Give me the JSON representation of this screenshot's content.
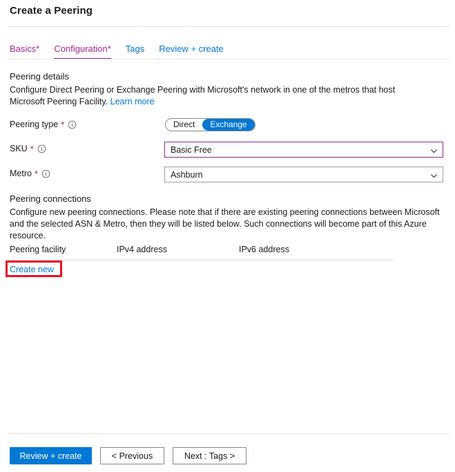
{
  "blade": {
    "title": "Create a Peering"
  },
  "tabs": [
    {
      "label": "Basics",
      "required": "*",
      "state": "visited",
      "selected": false
    },
    {
      "label": "Configuration",
      "required": "*",
      "state": "visited",
      "selected": true
    },
    {
      "label": "Tags",
      "required": "",
      "state": "link",
      "selected": false
    },
    {
      "label": "Review + create",
      "required": "",
      "state": "link",
      "selected": false
    }
  ],
  "peering_details": {
    "heading": "Peering details",
    "description": "Configure Direct Peering or Exchange Peering with Microsoft's network in one of the metros that host Microsoft Peering Facility.",
    "learn_more": "Learn more",
    "peering_type": {
      "label": "Peering type",
      "required": "*",
      "info_icon": "info-icon",
      "options": [
        "Direct",
        "Exchange"
      ],
      "selected": "Exchange"
    },
    "sku": {
      "label": "SKU",
      "required": "*",
      "info_icon": "info-icon",
      "value": "Basic Free",
      "chevron_icon": "chevron-down-icon"
    },
    "metro": {
      "label": "Metro",
      "required": "*",
      "info_icon": "info-icon",
      "value": "Ashburn",
      "chevron_icon": "chevron-down-icon"
    }
  },
  "peering_connections": {
    "heading": "Peering connections",
    "description": "Configure new peering connections. Please note that if there are existing peering connections between Microsoft and the selected ASN & Metro, then they will be listed below. Such connections will become part of this Azure resource.",
    "columns": [
      "Peering facility",
      "IPv4 address",
      "IPv6 address"
    ],
    "rows": [],
    "create_new": "Create new"
  },
  "footer": {
    "review_create": "Review + create",
    "previous": "< Previous",
    "next": "Next : Tags >"
  },
  "colors": {
    "accent_blue": "#0078d4",
    "tab_visited_purple": "#a4268f",
    "tab_underline_purple": "#8a2b8a",
    "required_red": "#a4262c",
    "highlight_red": "#e81123"
  }
}
